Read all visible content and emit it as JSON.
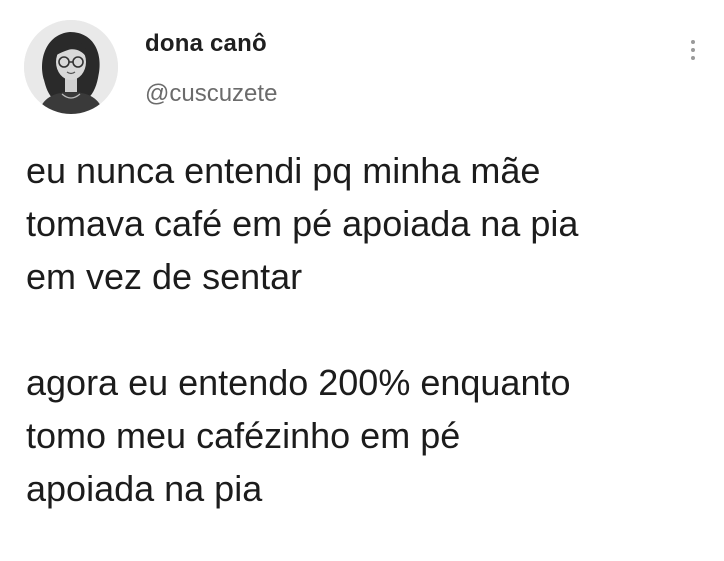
{
  "author": {
    "display_name": "dona canô",
    "handle": "@cuscuzete",
    "avatar_icon": "avatar-illustration-icon"
  },
  "menu_icon": "more-vertical-icon",
  "tweet": {
    "paragraph1": [
      "eu nunca entendi pq minha mãe",
      "tomava café em pé apoiada na pia",
      "em vez de sentar"
    ],
    "paragraph2": [
      "agora eu entendo 200% enquanto",
      "tomo meu cafézinho em pé",
      "apoiada na pia"
    ]
  },
  "colors": {
    "background": "#ffffff",
    "text": "#1c1c1c",
    "handle": "#6b6b6b"
  }
}
